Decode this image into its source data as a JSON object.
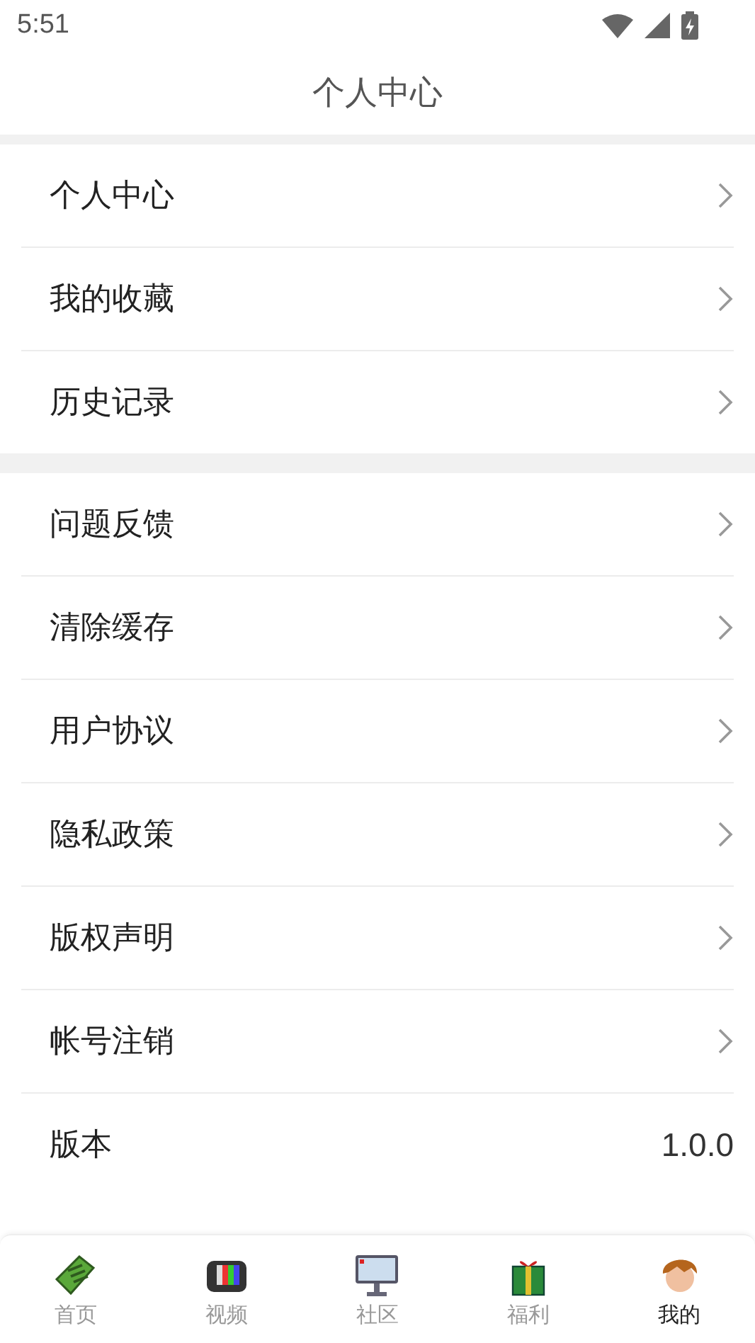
{
  "status_bar": {
    "time": "5:51"
  },
  "header": {
    "title": "个人中心"
  },
  "sections": [
    {
      "items": [
        {
          "kind": "link",
          "label": "个人中心"
        },
        {
          "kind": "link",
          "label": "我的收藏"
        },
        {
          "kind": "link",
          "label": "历史记录"
        }
      ]
    },
    {
      "items": [
        {
          "kind": "link",
          "label": "问题反馈"
        },
        {
          "kind": "link",
          "label": "清除缓存"
        },
        {
          "kind": "link",
          "label": "用户协议"
        },
        {
          "kind": "link",
          "label": "隐私政策"
        },
        {
          "kind": "link",
          "label": "版权声明"
        },
        {
          "kind": "link",
          "label": "帐号注销"
        },
        {
          "kind": "value",
          "label": "版本",
          "value": "1.0.0"
        }
      ]
    }
  ],
  "bottom_nav": [
    {
      "kind": "book",
      "label": "首页",
      "selected": false
    },
    {
      "kind": "tv",
      "label": "视频",
      "selected": false
    },
    {
      "kind": "board",
      "label": "社区",
      "selected": false
    },
    {
      "kind": "gift",
      "label": "福利",
      "selected": false
    },
    {
      "kind": "head",
      "label": "我的",
      "selected": true
    }
  ]
}
